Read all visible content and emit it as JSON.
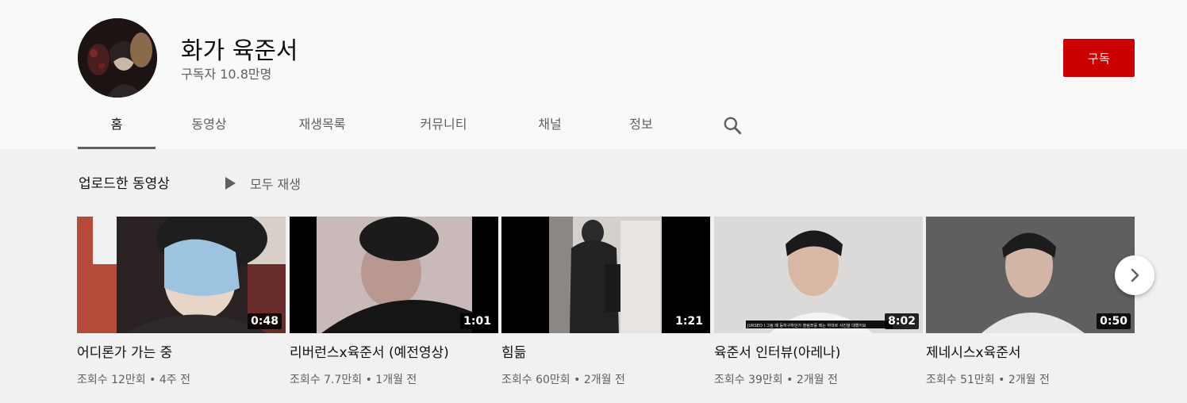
{
  "channel": {
    "name": "화가 육준서",
    "subscribers": "구독자 10.8만명",
    "subscribe_label": "구독",
    "subscribe_color": "#cc0000"
  },
  "tabs": [
    {
      "label": "홈",
      "active": true
    },
    {
      "label": "동영상"
    },
    {
      "label": "재생목록"
    },
    {
      "label": "커뮤니티"
    },
    {
      "label": "채널"
    },
    {
      "label": "정보"
    }
  ],
  "search_icon": "search-icon",
  "section": {
    "title": "업로드한 동영상",
    "play_all_label": "모두 재생",
    "play_icon": "play-icon"
  },
  "videos": [
    {
      "title": "어디론가 가는 중",
      "duration": "0:48",
      "views": "조회수 12만회",
      "age": "4주 전"
    },
    {
      "title": "리버런스x육준서 (예전영상)",
      "duration": "1:01",
      "views": "조회수 7.7만회",
      "age": "1개월 전"
    },
    {
      "title": "힘듦",
      "duration": "1:21",
      "views": "조회수 60만회",
      "age": "2개월 전"
    },
    {
      "title": "육준서 인터뷰(아레나)",
      "duration": "8:02",
      "views": "조회수 39만회",
      "age": "2개월 전",
      "caption": "JURSEO I  그림 때 등하구하던가 쓸림쪼를 메는 하마르 사진을 대했어요"
    },
    {
      "title": "제네시스x육준서",
      "duration": "0:50",
      "views": "조회수 51만회",
      "age": "2개월 전"
    }
  ],
  "separator": "•",
  "next_icon": "chevron-right-icon"
}
